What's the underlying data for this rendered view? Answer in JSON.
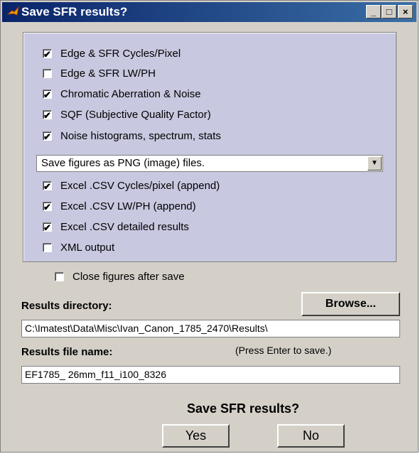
{
  "window": {
    "title": "Save SFR results?",
    "controls": {
      "minimize": "_",
      "maximize": "□",
      "close": "×"
    }
  },
  "options": [
    {
      "label": "Edge & SFR Cycles/Pixel",
      "checked": true
    },
    {
      "label": "Edge & SFR LW/PH",
      "checked": false
    },
    {
      "label": "Chromatic Aberration & Noise",
      "checked": true
    },
    {
      "label": "SQF (Subjective Quality Factor)",
      "checked": true
    },
    {
      "label": "Noise histograms, spectrum, stats",
      "checked": true
    }
  ],
  "format_select": {
    "value": "Save figures as PNG (image) files.",
    "arrow": "▼"
  },
  "csv_options": [
    {
      "label": "Excel .CSV Cycles/pixel (append)",
      "checked": true
    },
    {
      "label": "Excel .CSV LW/PH (append)",
      "checked": true
    },
    {
      "label": "Excel .CSV detailed results",
      "checked": true
    },
    {
      "label": "XML output",
      "checked": false
    }
  ],
  "close_figures": {
    "label": "Close figures after save",
    "checked": false
  },
  "results_directory": {
    "label": "Results directory:",
    "browse_label": "Browse...",
    "value": "C:\\Imatest\\Data\\Misc\\Ivan_Canon_1785_2470\\Results\\"
  },
  "results_file": {
    "label": "Results file name:",
    "hint": "(Press Enter to save.)",
    "value": "EF1785_ 26mm_f11_i100_8326"
  },
  "prompt": "Save SFR results?",
  "buttons": {
    "yes": "Yes",
    "no": "No"
  },
  "colors": {
    "titlebar": "#0a246a",
    "panel": "#c8c8e0",
    "window": "#d4d0c8"
  }
}
